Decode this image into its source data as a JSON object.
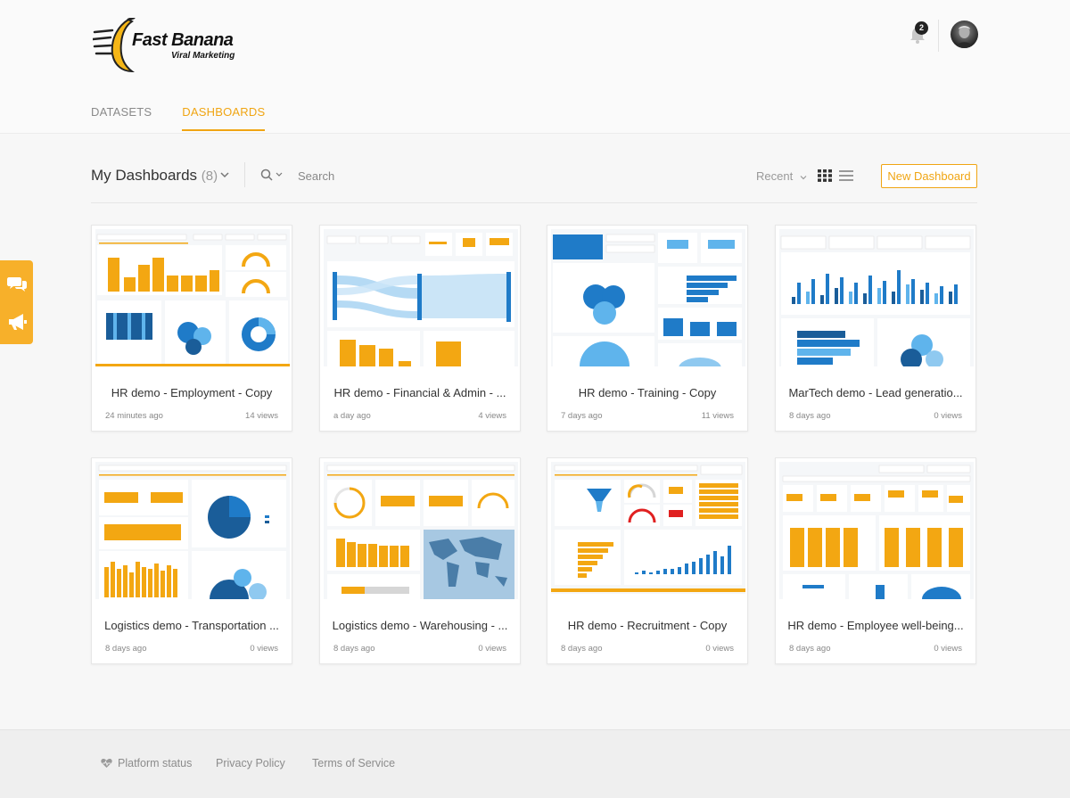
{
  "brand": {
    "name": "Fast Banana",
    "tagline": "Viral Marketing"
  },
  "header": {
    "notifications_count": "2"
  },
  "tabs": [
    {
      "label": "DATASETS",
      "active": false
    },
    {
      "label": "DASHBOARDS",
      "active": true
    }
  ],
  "toolbar": {
    "title": "My Dashboards",
    "count": "(8)",
    "search_placeholder": "Search",
    "sort_label": "Recent",
    "new_button": "New Dashboard"
  },
  "cards": [
    {
      "title": "HR demo - Employment - Copy",
      "time": "24 minutes ago",
      "views": "14 views"
    },
    {
      "title": "HR demo - Financial & Admin - ...",
      "time": "a day ago",
      "views": "4 views"
    },
    {
      "title": "HR demo - Training - Copy",
      "time": "7 days ago",
      "views": "11 views"
    },
    {
      "title": "MarTech demo - Lead generatio...",
      "time": "8 days ago",
      "views": "0 views"
    },
    {
      "title": "Logistics demo - Transportation ...",
      "time": "8 days ago",
      "views": "0 views"
    },
    {
      "title": "Logistics demo - Warehousing - ...",
      "time": "8 days ago",
      "views": "0 views"
    },
    {
      "title": "HR demo - Recruitment - Copy",
      "time": "8 days ago",
      "views": "0 views"
    },
    {
      "title": "HR demo - Employee well-being...",
      "time": "8 days ago",
      "views": "0 views"
    }
  ],
  "footer": {
    "status": "Platform status",
    "privacy": "Privacy Policy",
    "terms": "Terms of Service"
  },
  "colors": {
    "accent": "#f0a513",
    "blue": "#1f7bc8",
    "light_blue": "#5fb4ec"
  }
}
